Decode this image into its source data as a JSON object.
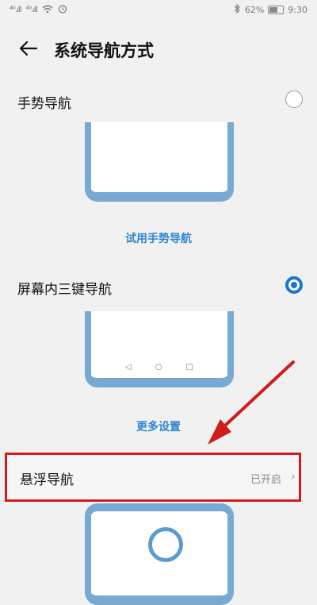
{
  "status_bar": {
    "left_signals": [
      "⁴ᴳ.ıll",
      "⁴ᴳ.ıll"
    ],
    "wifi_icon": "wifi-icon",
    "alarm_icon": "alarm-icon",
    "bluetooth_icon": "bluetooth-icon",
    "battery_percent": "62%",
    "time": "9:30"
  },
  "header": {
    "title": "系统导航方式",
    "back_icon": "back-arrow-icon"
  },
  "options": {
    "gesture": {
      "label": "手势导航",
      "selected": false,
      "try_link": "试用手势导航"
    },
    "three_key": {
      "label": "屏幕内三键导航",
      "selected": true,
      "keys": [
        "◁",
        "○",
        "□"
      ],
      "more_settings": "更多设置"
    },
    "floating": {
      "label": "悬浮导航",
      "status": "已开启",
      "chevron": "›"
    }
  },
  "colors": {
    "accent": "#1976d2",
    "link": "#2f86cf",
    "phone_frame": "#78a9d3",
    "annotation_red": "#d11c1c"
  }
}
